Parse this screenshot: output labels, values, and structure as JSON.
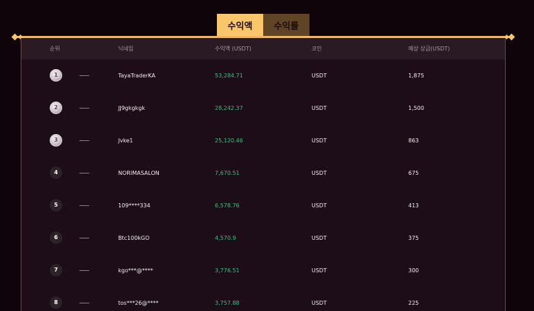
{
  "tabs": {
    "profit_amount": "수익액",
    "profit_rate": "수익률"
  },
  "table": {
    "headers": {
      "rank": "순위",
      "nickname": "닉네임",
      "profit": "수익액 (USDT)",
      "coin": "코인",
      "prize": "예상 상금(USDT)"
    },
    "rows": [
      {
        "rank": "1",
        "nickname": "TayaTraderKA",
        "profit": "53,284.71",
        "coin": "USDT",
        "prize": "1,875",
        "medal": true
      },
      {
        "rank": "2",
        "nickname": "JJ9gkgkgk",
        "profit": "28,242.37",
        "coin": "USDT",
        "prize": "1,500",
        "medal": true
      },
      {
        "rank": "3",
        "nickname": "Jvke1",
        "profit": "25,120.46",
        "coin": "USDT",
        "prize": "863",
        "medal": true
      },
      {
        "rank": "4",
        "nickname": "NORIMASALON",
        "profit": "7,670.51",
        "coin": "USDT",
        "prize": "675",
        "medal": false
      },
      {
        "rank": "5",
        "nickname": "109****334",
        "profit": "6,578.76",
        "coin": "USDT",
        "prize": "413",
        "medal": false
      },
      {
        "rank": "6",
        "nickname": "Btc100kGO",
        "profit": "4,570.9",
        "coin": "USDT",
        "prize": "375",
        "medal": false
      },
      {
        "rank": "7",
        "nickname": "kgo***@****",
        "profit": "3,776.51",
        "coin": "USDT",
        "prize": "300",
        "medal": false
      },
      {
        "rank": "8",
        "nickname": "tos***26@****",
        "profit": "3,757.88",
        "coin": "USDT",
        "prize": "225",
        "medal": false
      }
    ]
  },
  "colors": {
    "accent": "#f9c66c",
    "profit_green": "#3fbf82",
    "panel_bg": "#1d0d18",
    "page_bg": "#0e0409"
  }
}
